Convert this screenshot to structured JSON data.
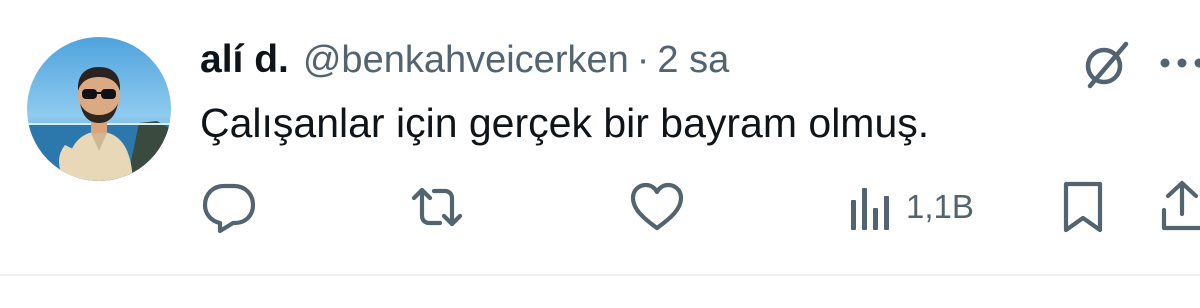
{
  "author": {
    "name": "alí d.",
    "handle": "@benkahveicerken",
    "separator": "·",
    "time": "2 sa"
  },
  "tweet": {
    "text": "Çalışanlar için gerçek bir bayram olmuş."
  },
  "actions": {
    "views_count": "1,1B"
  },
  "icons": {
    "reply": "reply-icon",
    "retweet": "retweet-icon",
    "like": "heart-icon",
    "views": "views-icon",
    "bookmark": "bookmark-icon",
    "share": "share-icon",
    "grok": "grok-icon",
    "more": "more-icon"
  },
  "colors": {
    "text_primary": "#0f1419",
    "text_secondary": "#536471",
    "divider": "#eff3f4"
  }
}
